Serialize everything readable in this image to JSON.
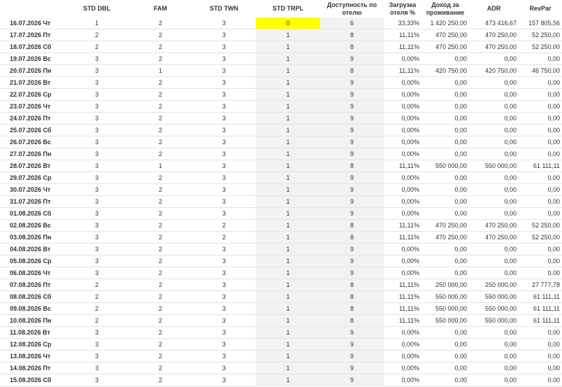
{
  "columns": [
    "",
    "STD DBL",
    "FAM",
    "STD TWN",
    "STD TRPL",
    "Доступность по отелю",
    "Загрузка отеля %",
    "Доход за проживание",
    "ADR",
    "RevPar"
  ],
  "highlight_color": "#ffff00",
  "rows": [
    [
      "16.07.2026 Чт",
      "1",
      "2",
      "3",
      "0",
      "6",
      "33,33%",
      "1 420 250,00",
      "473 416,67",
      "157 805,56"
    ],
    [
      "17.07.2026 Пт",
      "2",
      "2",
      "3",
      "1",
      "8",
      "11,11%",
      "470 250,00",
      "470 250,00",
      "52 250,00"
    ],
    [
      "18.07.2026 Сб",
      "2",
      "2",
      "3",
      "1",
      "8",
      "11,11%",
      "470 250,00",
      "470 250,00",
      "52 250,00"
    ],
    [
      "19.07.2026 Вс",
      "3",
      "2",
      "3",
      "1",
      "9",
      "0,00%",
      "0,00",
      "0,00",
      "0,00"
    ],
    [
      "20.07.2026 Пн",
      "3",
      "1",
      "3",
      "1",
      "8",
      "11,11%",
      "420 750,00",
      "420 750,00",
      "46 750,00"
    ],
    [
      "21.07.2026 Вт",
      "3",
      "2",
      "3",
      "1",
      "9",
      "0,00%",
      "0,00",
      "0,00",
      "0,00"
    ],
    [
      "22.07.2026 Ср",
      "3",
      "2",
      "3",
      "1",
      "9",
      "0,00%",
      "0,00",
      "0,00",
      "0,00"
    ],
    [
      "23.07.2026 Чт",
      "3",
      "2",
      "3",
      "1",
      "9",
      "0,00%",
      "0,00",
      "0,00",
      "0,00"
    ],
    [
      "24.07.2026 Пт",
      "3",
      "2",
      "3",
      "1",
      "9",
      "0,00%",
      "0,00",
      "0,00",
      "0,00"
    ],
    [
      "25.07.2026 Сб",
      "3",
      "2",
      "3",
      "1",
      "9",
      "0,00%",
      "0,00",
      "0,00",
      "0,00"
    ],
    [
      "26.07.2026 Вс",
      "3",
      "2",
      "3",
      "1",
      "9",
      "0,00%",
      "0,00",
      "0,00",
      "0,00"
    ],
    [
      "27.07.2026 Пн",
      "3",
      "2",
      "3",
      "1",
      "9",
      "0,00%",
      "0,00",
      "0,00",
      "0,00"
    ],
    [
      "28.07.2026 Вт",
      "3",
      "1",
      "3",
      "1",
      "8",
      "11,11%",
      "550 000,00",
      "550 000,00",
      "61 111,11"
    ],
    [
      "29.07.2026 Ср",
      "3",
      "2",
      "3",
      "1",
      "9",
      "0,00%",
      "0,00",
      "0,00",
      "0,00"
    ],
    [
      "30.07.2026 Чт",
      "3",
      "2",
      "3",
      "1",
      "9",
      "0,00%",
      "0,00",
      "0,00",
      "0,00"
    ],
    [
      "31.07.2026 Пт",
      "3",
      "2",
      "3",
      "1",
      "9",
      "0,00%",
      "0,00",
      "0,00",
      "0,00"
    ],
    [
      "01.08.2026 Сб",
      "3",
      "2",
      "3",
      "1",
      "9",
      "0,00%",
      "0,00",
      "0,00",
      "0,00"
    ],
    [
      "02.08.2026 Вс",
      "3",
      "2",
      "2",
      "1",
      "8",
      "11,11%",
      "470 250,00",
      "470 250,00",
      "52 250,00"
    ],
    [
      "03.08.2026 Пн",
      "3",
      "2",
      "2",
      "1",
      "8",
      "11,11%",
      "470 250,00",
      "470 250,00",
      "52 250,00"
    ],
    [
      "04.08.2026 Вт",
      "3",
      "2",
      "3",
      "1",
      "9",
      "0,00%",
      "0,00",
      "0,00",
      "0,00"
    ],
    [
      "05.08.2026 Ср",
      "3",
      "2",
      "3",
      "1",
      "9",
      "0,00%",
      "0,00",
      "0,00",
      "0,00"
    ],
    [
      "06.08.2026 Чт",
      "3",
      "2",
      "3",
      "1",
      "9",
      "0,00%",
      "0,00",
      "0,00",
      "0,00"
    ],
    [
      "07.08.2026 Пт",
      "2",
      "2",
      "3",
      "1",
      "8",
      "11,11%",
      "250 000,00",
      "250 000,00",
      "27 777,78"
    ],
    [
      "08.08.2026 Сб",
      "2",
      "2",
      "3",
      "1",
      "8",
      "11,11%",
      "550 000,00",
      "550 000,00",
      "61 111,11"
    ],
    [
      "09.08.2026 Вс",
      "2",
      "2",
      "3",
      "1",
      "8",
      "11,11%",
      "550 000,00",
      "550 000,00",
      "61 111,11"
    ],
    [
      "10.08.2026 Пн",
      "2",
      "2",
      "3",
      "1",
      "8",
      "11,11%",
      "550 000,00",
      "550 000,00",
      "61 111,11"
    ],
    [
      "11.08.2026 Вт",
      "3",
      "2",
      "3",
      "1",
      "9",
      "0,00%",
      "0,00",
      "0,00",
      "0,00"
    ],
    [
      "12.08.2026 Ср",
      "3",
      "2",
      "3",
      "1",
      "9",
      "0,00%",
      "0,00",
      "0,00",
      "0,00"
    ],
    [
      "13.08.2026 Чт",
      "3",
      "2",
      "3",
      "1",
      "9",
      "0,00%",
      "0,00",
      "0,00",
      "0,00"
    ],
    [
      "14.08.2026 Пт",
      "3",
      "2",
      "3",
      "1",
      "9",
      "0,00%",
      "0,00",
      "0,00",
      "0,00"
    ],
    [
      "15.08.2026 Сб",
      "3",
      "2",
      "3",
      "1",
      "9",
      "0,00%",
      "0,00",
      "0,00",
      "0,00"
    ]
  ]
}
